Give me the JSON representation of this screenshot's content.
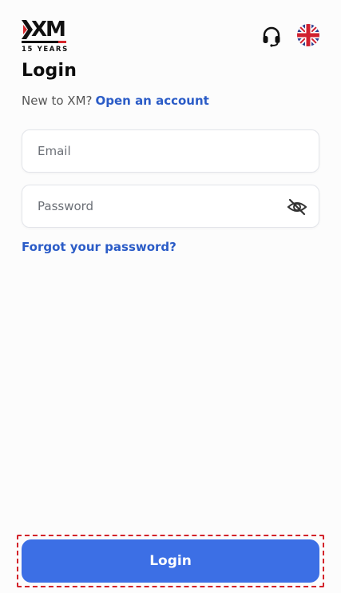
{
  "brand": {
    "logo_text": "XM",
    "logo_tagline": "15 YEARS",
    "accent_red": "#d6282c"
  },
  "header": {
    "support_icon": "headset-icon",
    "language_icon": "uk-flag-icon"
  },
  "page": {
    "title": "Login",
    "new_user_prompt": "New to XM?",
    "open_account_link": "Open an account",
    "link_color": "#2b5cc7"
  },
  "form": {
    "email": {
      "value": "",
      "placeholder": "Email"
    },
    "password": {
      "value": "",
      "placeholder": "Password",
      "toggle_icon": "eye-off-icon"
    },
    "forgot_link": "Forgot your password?"
  },
  "footer": {
    "login_button": "Login",
    "button_color": "#3c6fe5"
  }
}
